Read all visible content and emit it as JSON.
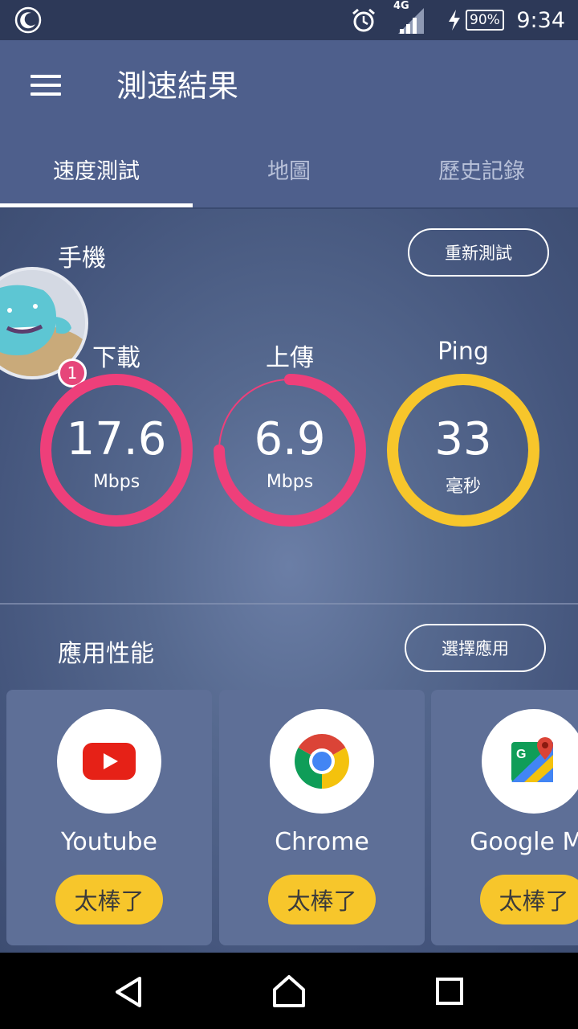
{
  "status_bar": {
    "time": "9:34",
    "battery": "90%",
    "network": "4G",
    "icons": [
      "moon-icon",
      "alarm-icon",
      "signal-icon",
      "battery-charging-icon"
    ]
  },
  "app_bar": {
    "title": "測速結果",
    "menu_icon": "hamburger-menu-icon"
  },
  "tabs": [
    {
      "label": "速度測試",
      "active": true
    },
    {
      "label": "地圖",
      "active": false
    },
    {
      "label": "歷史記錄",
      "active": false
    }
  ],
  "phone_section": {
    "title": "手機",
    "retest_label": "重新測試",
    "badge_count": "1"
  },
  "gauges": [
    {
      "label": "下載",
      "value": "17.6",
      "unit": "Mbps",
      "color": "#ee3f7a",
      "fill": 1.0
    },
    {
      "label": "上傳",
      "value": "6.9",
      "unit": "Mbps",
      "color": "#ee3f7a",
      "fill": 0.75
    },
    {
      "label": "Ping",
      "value": "33",
      "unit": "毫秒",
      "color": "#f7c62b",
      "fill": 1.0
    }
  ],
  "apps_section": {
    "title": "應用性能",
    "select_label": "選擇應用",
    "apps": [
      {
        "name": "Youtube",
        "rating": "太棒了",
        "icon": "youtube-icon"
      },
      {
        "name": "Chrome",
        "rating": "太棒了",
        "icon": "chrome-icon"
      },
      {
        "name": "Google Ma",
        "rating": "太棒了",
        "icon": "google-maps-icon"
      }
    ]
  },
  "nav_bar": {
    "icons": [
      "back-icon",
      "home-icon",
      "recents-icon"
    ]
  },
  "colors": {
    "header": "#4e5f8c",
    "status_bar": "#2d3958",
    "accent_pink": "#ee3f7a",
    "accent_yellow": "#f7c62b"
  }
}
